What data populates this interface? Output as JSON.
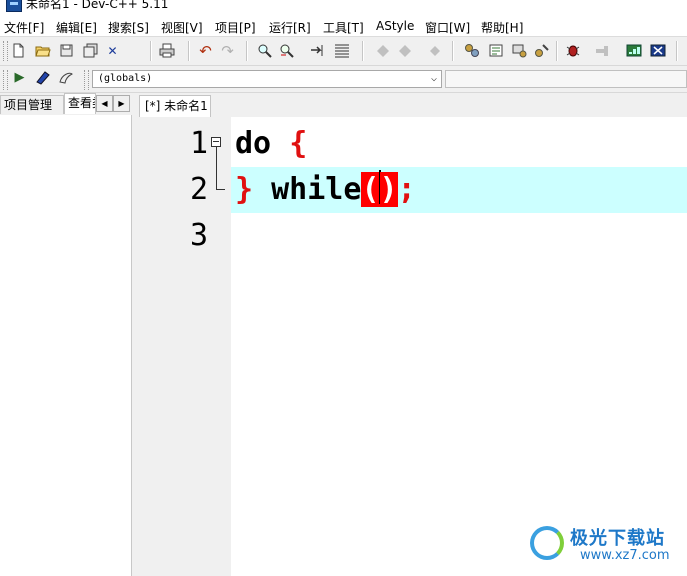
{
  "window": {
    "title": "未命名1 - Dev-C++ 5.11"
  },
  "menu": [
    {
      "label": "文件[F]"
    },
    {
      "label": "编辑[E]"
    },
    {
      "label": "搜索[S]"
    },
    {
      "label": "视图[V]"
    },
    {
      "label": "项目[P]"
    },
    {
      "label": "运行[R]"
    },
    {
      "label": "工具[T]"
    },
    {
      "label": "AStyle"
    },
    {
      "label": "窗口[W]"
    },
    {
      "label": "帮助[H]"
    }
  ],
  "toolbar": {
    "new_icon": "new-file-icon",
    "open_icon": "open-folder-icon",
    "save_icon": "save-icon",
    "save_all_icon": "save-all-icon",
    "close_glyph": "✕",
    "print_icon": "print-icon",
    "undo_glyph": "↶",
    "redo_glyph": "↷",
    "run_glyph": "▶"
  },
  "scope_combo": {
    "value": "(globals)",
    "arrow": "⌵"
  },
  "left_panel": {
    "tabs": [
      {
        "label": "项目管理"
      },
      {
        "label": "查看类"
      }
    ],
    "scroll_left": "◀",
    "scroll_right": "▶"
  },
  "editor": {
    "tab_label": "[*] 未命名1",
    "line_numbers": [
      "1",
      "2",
      "3"
    ],
    "lines": {
      "l1_kw": "do",
      "l1_brace": "{",
      "l2_brace": "}",
      "l2_kw": "while",
      "l2_open": "(",
      "l2_close": ")",
      "l2_semi": ";"
    }
  },
  "watermark": {
    "title": "极光下载站",
    "url": "www.xz7.com"
  },
  "colors": {
    "current_line": "#ccffff",
    "bracket_highlight": "#ff0000",
    "brace": "#e01010"
  }
}
